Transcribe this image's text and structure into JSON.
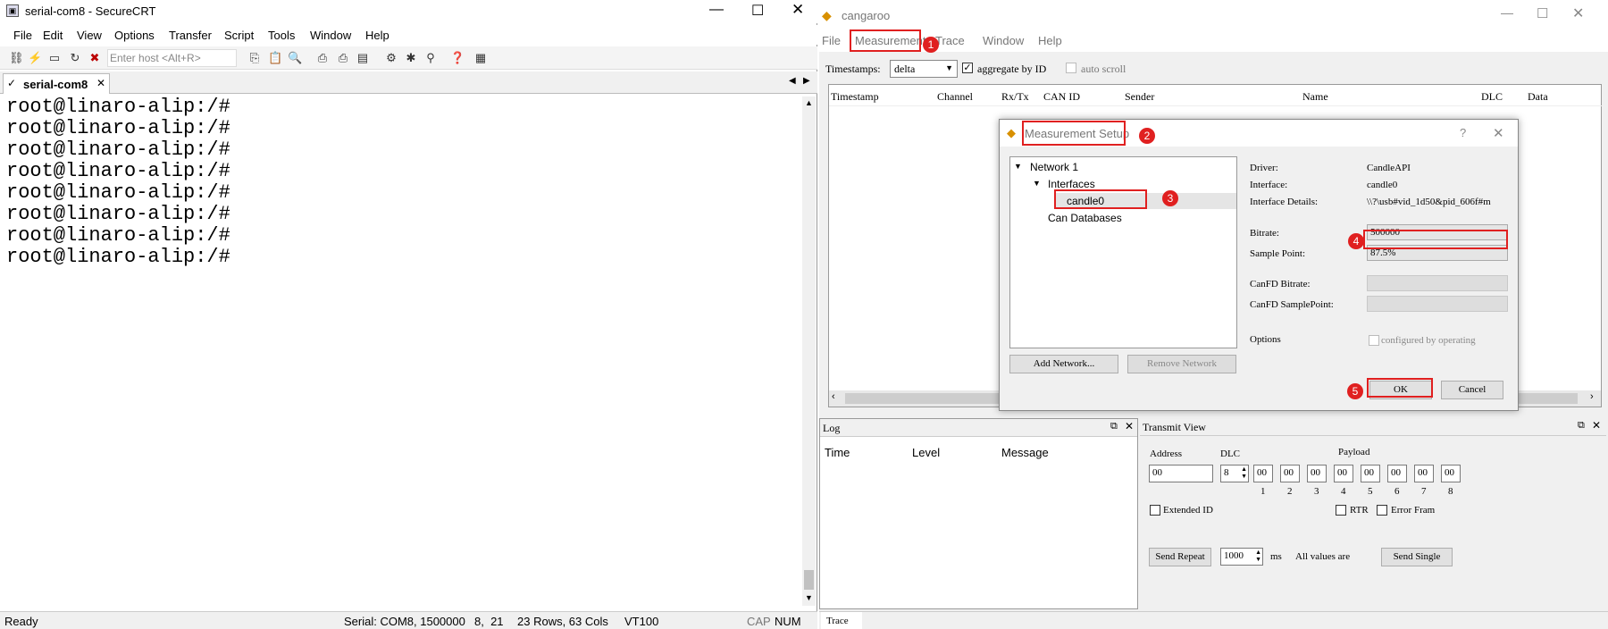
{
  "securecrt": {
    "title": "serial-com8 - SecureCRT",
    "menu": [
      "File",
      "Edit",
      "View",
      "Options",
      "Transfer",
      "Script",
      "Tools",
      "Window",
      "Help"
    ],
    "host_placeholder": "Enter host <Alt+R>",
    "tab_label": "serial-com8",
    "terminal_lines": [
      "root@linaro-alip:/#",
      "root@linaro-alip:/#",
      "root@linaro-alip:/#",
      "root@linaro-alip:/#",
      "root@linaro-alip:/#",
      "root@linaro-alip:/#",
      "root@linaro-alip:/#",
      "root@linaro-alip:/#"
    ],
    "status": {
      "ready": "Ready",
      "serial": "Serial: COM8, 1500000",
      "pos": "8,  21",
      "size": "23 Rows, 63 Cols",
      "term": "VT100",
      "cap": "CAP",
      "num": "NUM"
    }
  },
  "cangaroo": {
    "title": "cangaroo",
    "menu": [
      "File",
      "Measurement",
      "Trace",
      "Window",
      "Help"
    ],
    "timestamps_label": "Timestamps:",
    "timestamps_value": "delta",
    "aggregate_label": "aggregate by ID",
    "autoscroll_label": "auto scroll",
    "columns": [
      "Timestamp",
      "Channel",
      "Rx/Tx",
      "CAN ID",
      "Sender",
      "Name",
      "DLC",
      "Data"
    ],
    "log": {
      "title": "Log",
      "columns": [
        "Time",
        "Level",
        "Message"
      ]
    },
    "transmit": {
      "title": "Transmit View",
      "address_label": "Address",
      "dlc_label": "DLC",
      "payload_label": "Payload",
      "address_value": "00",
      "dlc_value": "8",
      "payload": [
        "00",
        "00",
        "00",
        "00",
        "00",
        "00",
        "00",
        "00"
      ],
      "indices": [
        "1",
        "2",
        "3",
        "4",
        "5",
        "6",
        "7",
        "8"
      ],
      "extended_label": "Extended ID",
      "rtr_label": "RTR",
      "error_label": "Error Fram",
      "send_repeat": "Send Repeat",
      "repeat_value": "1000",
      "ms": "ms",
      "all_values": "All values are",
      "send_single": "Send Single"
    },
    "bottom_tab": "Trace"
  },
  "dialog": {
    "title": "Measurement Setup",
    "help": "?",
    "tree": {
      "network": "Network 1",
      "interfaces": "Interfaces",
      "candle": "candle0",
      "databases": "Can Databases"
    },
    "add_network": "Add Network...",
    "remove_network": "Remove Network",
    "fields": {
      "driver_label": "Driver:",
      "driver_value": "CandleAPI",
      "interface_label": "Interface:",
      "interface_value": "candle0",
      "details_label": "Interface Details:",
      "details_value": "\\\\?\\usb#vid_1d50&pid_606f#m",
      "bitrate_label": "Bitrate:",
      "bitrate_value": "500000",
      "sample_label": "Sample Point:",
      "sample_value": "87.5%",
      "canfd_bitrate_label": "CanFD Bitrate:",
      "canfd_sample_label": "CanFD SamplePoint:",
      "options_label": "Options",
      "configured_label": "configured by operating"
    },
    "ok": "OK",
    "cancel": "Cancel"
  },
  "badges": [
    "1",
    "2",
    "3",
    "4",
    "5"
  ],
  "colors": {
    "annotation_red": "#e02020",
    "selection": "#cce8ff"
  }
}
